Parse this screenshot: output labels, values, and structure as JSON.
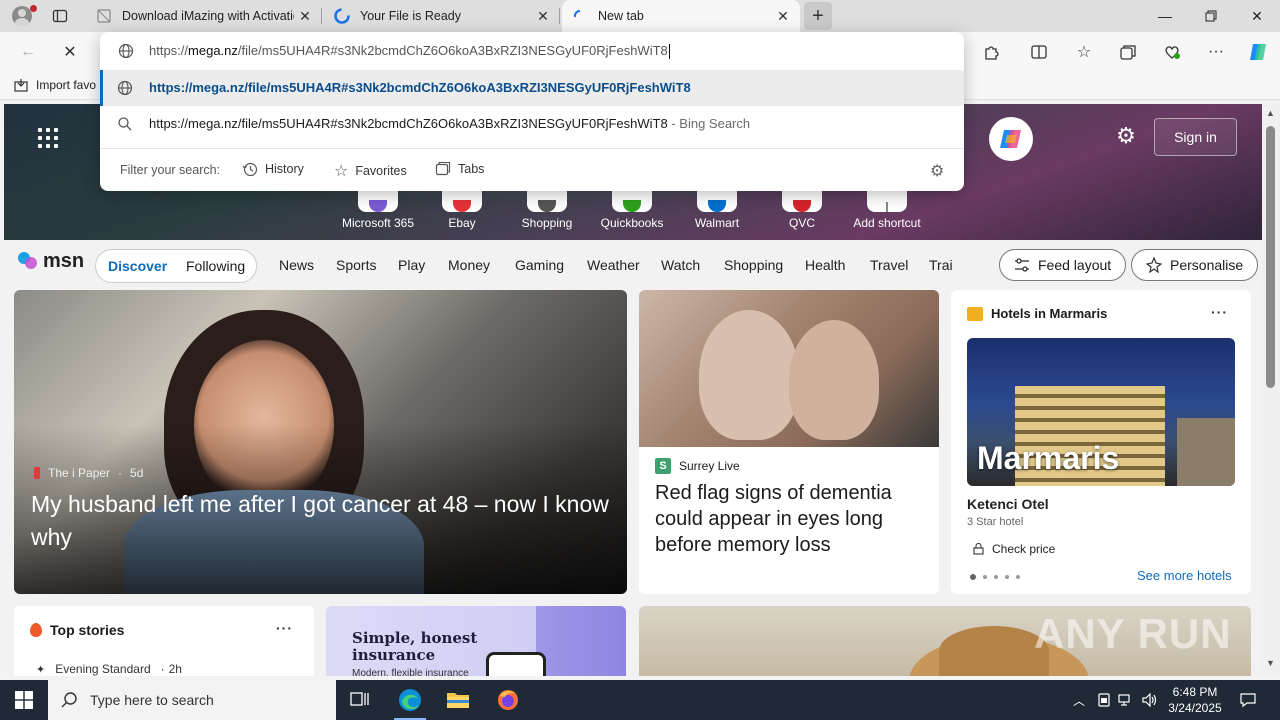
{
  "colors": {
    "accent": "#0f6cbd",
    "taskbar": "#1f2a36",
    "tabstrip": "#dedede"
  },
  "tabs": [
    {
      "title": "Download iMazing with Activatio",
      "icon": "page-icon"
    },
    {
      "title": "Your File is Ready",
      "icon": "edge-loading-icon"
    },
    {
      "title": "New tab",
      "icon": "loading-spinner-icon",
      "active": true
    }
  ],
  "omnibox": {
    "input_prefix": "https://",
    "input_host": "mega.nz",
    "input_rest": "/file/ms5UHA4R#s3Nk2bcmdChZ6O6koA3BxRZI3NESGyUF0RjFeshWiT8",
    "suggestions": [
      {
        "text": "https://mega.nz/file/ms5UHA4R#s3Nk2bcmdChZ6O6koA3BxRZI3NESGyUF0RjFeshWiT8",
        "suffix": ""
      },
      {
        "text": "https://mega.nz/file/ms5UHA4R#s3Nk2bcmdChZ6O6koA3BxRZI3NESGyUF0RjFeshWiT8",
        "suffix": " - Bing Search"
      }
    ],
    "filter_label": "Filter your search:",
    "filters": [
      "History",
      "Favorites",
      "Tabs"
    ]
  },
  "favbar": {
    "import_label": "Import favo"
  },
  "hero": {
    "sign_in": "Sign in",
    "shortcuts": [
      {
        "label": "Microsoft 365",
        "color": "#7b5cd6"
      },
      {
        "label": "Ebay",
        "color": "#e53238"
      },
      {
        "label": "Shopping",
        "color": "#555555"
      },
      {
        "label": "Quickbooks",
        "color": "#2ca01c"
      },
      {
        "label": "Walmart",
        "color": "#0071ce"
      },
      {
        "label": "QVC",
        "color": "#d6242a"
      },
      {
        "label": "Add shortcut",
        "color": "#888888"
      }
    ]
  },
  "nav": {
    "logo": "msn",
    "pill": [
      "Discover",
      "Following"
    ],
    "links": [
      "News",
      "Sports",
      "Play",
      "Money",
      "Gaming",
      "Weather",
      "Watch",
      "Shopping",
      "Health",
      "Travel",
      "Trai"
    ],
    "feed_layout": "Feed layout",
    "personalise": "Personalise"
  },
  "cards": {
    "hero": {
      "source": "The i Paper",
      "age": "5d",
      "headline": "My husband left me after I got cancer at 48 – now I know why"
    },
    "dementia": {
      "source_logo": "S",
      "source": "Surrey Live",
      "headline": "Red flag signs of dementia could appear in eyes long before memory loss"
    },
    "hotels": {
      "title": "Hotels in Marmaris",
      "city": "Marmaris",
      "hotel_name": "Ketenci Otel",
      "rating": "3 Star hotel",
      "check_price": "Check price",
      "see_more": "See more hotels"
    },
    "top_stories": {
      "title": "Top stories",
      "source": "Evening Standard",
      "age": "2h"
    },
    "insurance": {
      "title": "Simple, honest insurance",
      "subtitle": "Modern, flexible insurance"
    }
  },
  "watermark": "ANY RUN",
  "taskbar": {
    "search_placeholder": "Type here to search",
    "time": "6:48 PM",
    "date": "3/24/2025"
  }
}
